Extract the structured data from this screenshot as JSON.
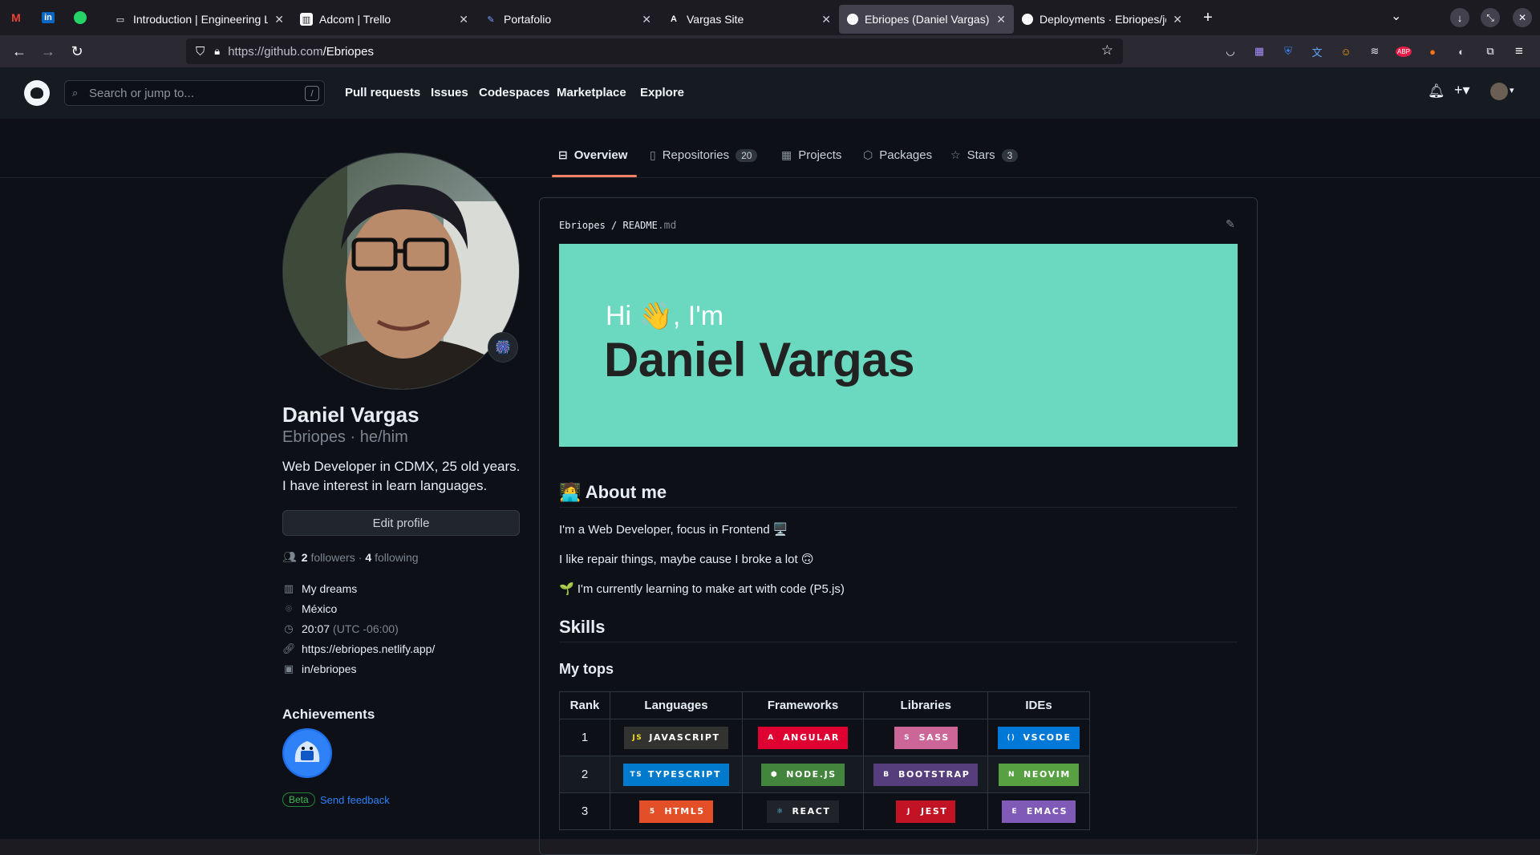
{
  "browser": {
    "tabs": [
      {
        "title": "Introduction | Engineering La",
        "favicon": "book-icon",
        "active": false
      },
      {
        "title": "Adcom | Trello",
        "favicon": "trello-icon",
        "active": false
      },
      {
        "title": "Portafolio",
        "favicon": "pen-icon",
        "active": false
      },
      {
        "title": "Vargas Site",
        "favicon": "a-logo-icon",
        "active": false
      },
      {
        "title": "Ebriopes (Daniel Vargas)",
        "favicon": "github-icon",
        "active": true
      },
      {
        "title": "Deployments · Ebriopes/jo",
        "favicon": "github-icon",
        "active": false
      }
    ],
    "url_domain": "https://github.com",
    "url_path": "/Ebriopes"
  },
  "github": {
    "search_placeholder": "Search or jump to...",
    "search_shortcut": "/",
    "nav": [
      "Pull requests",
      "Issues",
      "Codespaces",
      "Marketplace",
      "Explore"
    ]
  },
  "profile_tabs": {
    "overview": "Overview",
    "repositories": "Repositories",
    "repositories_count": "20",
    "projects": "Projects",
    "packages": "Packages",
    "stars": "Stars",
    "stars_count": "3"
  },
  "profile": {
    "name": "Daniel Vargas",
    "login_line": "Ebriopes · he/him",
    "bio": "Web Developer in CDMX, 25 old years. I have interest in learn languages.",
    "edit_button": "Edit profile",
    "followers_count": "2",
    "followers_label": "followers",
    "following_count": "4",
    "following_label": "following",
    "company": "My dreams",
    "location": "México",
    "time": "20:07",
    "timezone": "(UTC -06:00)",
    "website": "https://ebriopes.netlify.app/",
    "linkedin": "in/ebriopes",
    "achievements_title": "Achievements",
    "beta_label": "Beta",
    "feedback_link": "Send feedback"
  },
  "readme": {
    "owner": "Ebriopes",
    "file": "README",
    "ext": ".md",
    "greeting": "Hi 👋, I'm",
    "name": "Daniel Vargas",
    "banner_color": "#6bd9bf",
    "about_title": "🧑‍💻 About me",
    "about_lines": [
      "I'm a Web Developer, focus in Frontend 🖥️",
      "I like repair things, maybe cause I broke a lot 🙃",
      "🌱 I'm currently learning to make art with code (P5.js)"
    ],
    "skills_title": "Skills",
    "tops_title": "My tops",
    "table": {
      "headers": [
        "Rank",
        "Languages",
        "Frameworks",
        "Libraries",
        "IDEs"
      ],
      "rows": [
        {
          "rank": "1",
          "cells": [
            {
              "label": "JAVASCRIPT",
              "color": "#323330",
              "icon_color": "#f7df1e",
              "icon": "JS"
            },
            {
              "label": "ANGULAR",
              "color": "#dd0031",
              "icon_color": "#ffffff",
              "icon": "A"
            },
            {
              "label": "SASS",
              "color": "#cc6699",
              "icon_color": "#ffffff",
              "icon": "S"
            },
            {
              "label": "VSCODE",
              "color": "#0078d7",
              "icon_color": "#ffffff",
              "icon": "⟨⟩"
            }
          ]
        },
        {
          "rank": "2",
          "cells": [
            {
              "label": "TYPESCRIPT",
              "color": "#007acc",
              "icon_color": "#ffffff",
              "icon": "TS"
            },
            {
              "label": "NODE.JS",
              "color": "#43853d",
              "icon_color": "#ffffff",
              "icon": "⬢"
            },
            {
              "label": "BOOTSTRAP",
              "color": "#563d7c",
              "icon_color": "#ffffff",
              "icon": "B"
            },
            {
              "label": "NEOVIM",
              "color": "#57a143",
              "icon_color": "#ffffff",
              "icon": "N"
            }
          ]
        },
        {
          "rank": "3",
          "cells": [
            {
              "label": "HTML5",
              "color": "#e34f26",
              "icon_color": "#ffffff",
              "icon": "5"
            },
            {
              "label": "REACT",
              "color": "#20232a",
              "icon_color": "#61dafb",
              "icon": "⚛"
            },
            {
              "label": "JEST",
              "color": "#c21325",
              "icon_color": "#ffffff",
              "icon": "J"
            },
            {
              "label": "EMACS",
              "color": "#7f5ab6",
              "icon_color": "#ffffff",
              "icon": "E"
            }
          ]
        }
      ]
    }
  }
}
